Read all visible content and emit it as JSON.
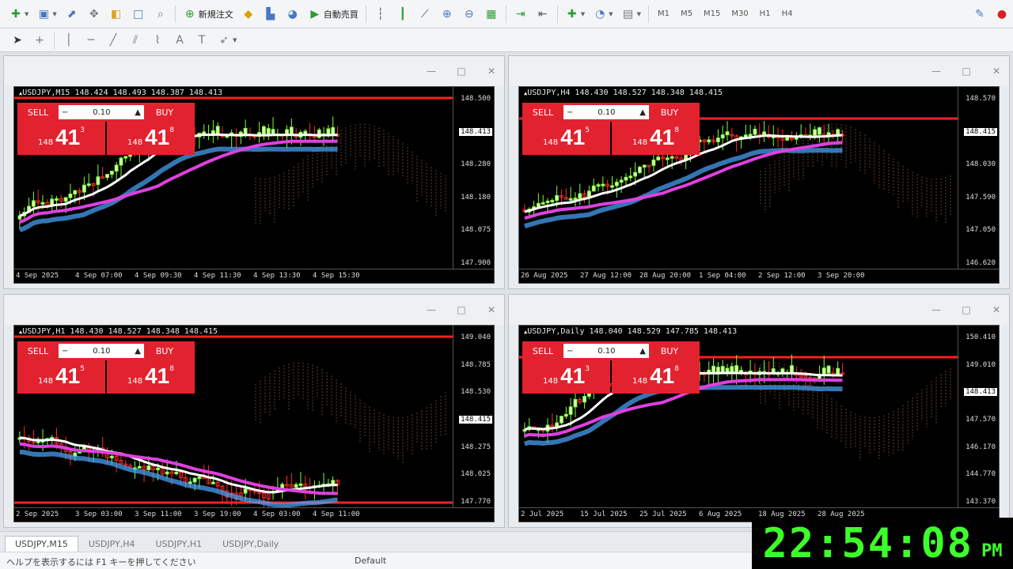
{
  "toolbar": {
    "items": [
      {
        "name": "new-chart-icon",
        "glyph": "✚",
        "color": "#2e9b3a",
        "dropdown": true
      },
      {
        "name": "profiles-icon",
        "glyph": "▣",
        "color": "#4a78c2",
        "dropdown": true
      },
      {
        "name": "market-watch-icon",
        "glyph": "⬈",
        "color": "#4a78c2"
      },
      {
        "name": "data-window-icon",
        "glyph": "✥",
        "color": "#777"
      },
      {
        "name": "navigator-icon",
        "glyph": "◧",
        "color": "#e0a020"
      },
      {
        "name": "terminal-icon",
        "glyph": "□",
        "color": "#4a78c2"
      },
      {
        "name": "strategy-tester-icon",
        "glyph": "⌕",
        "color": "#777"
      },
      {
        "sep": true
      },
      {
        "name": "new-order-icon",
        "glyph": "⊕",
        "color": "#2e9b3a",
        "text": "新規注文"
      },
      {
        "name": "metaeditor-icon",
        "glyph": "◆",
        "color": "#d9a000"
      },
      {
        "name": "signals-icon",
        "glyph": "▙",
        "color": "#4a78c2"
      },
      {
        "name": "market-icon",
        "glyph": "◕",
        "color": "#4a78c2"
      },
      {
        "name": "auto-trading-icon",
        "glyph": "▶",
        "color": "#2e9b3a",
        "text": "自動売買"
      },
      {
        "sep": true
      },
      {
        "name": "bar-chart-icon",
        "glyph": "┆",
        "color": "#555"
      },
      {
        "name": "candle-chart-icon",
        "glyph": "┃",
        "color": "#2e9b3a"
      },
      {
        "name": "line-chart-icon",
        "glyph": "⟋",
        "color": "#555"
      },
      {
        "name": "zoom-in-icon",
        "glyph": "⊕",
        "color": "#4a78c2"
      },
      {
        "name": "zoom-out-icon",
        "glyph": "⊖",
        "color": "#4a78c2"
      },
      {
        "name": "tile-windows-icon",
        "glyph": "▦",
        "color": "#2e9b3a"
      },
      {
        "sep": true
      },
      {
        "name": "auto-scroll-icon",
        "glyph": "⇥",
        "color": "#2e9b3a"
      },
      {
        "name": "chart-shift-icon",
        "glyph": "⇤",
        "color": "#555"
      },
      {
        "sep": true
      },
      {
        "name": "indicators-icon",
        "glyph": "✚",
        "color": "#2e9b3a",
        "dropdown": true
      },
      {
        "name": "periods-icon",
        "glyph": "◔",
        "color": "#4a78c2",
        "dropdown": true
      },
      {
        "name": "templates-icon",
        "glyph": "▤",
        "color": "#777",
        "dropdown": true
      }
    ],
    "timeframes": [
      "M1",
      "M5",
      "M15",
      "M30",
      "H1",
      "H4"
    ],
    "right_icons": [
      {
        "name": "options-icon",
        "glyph": "✎",
        "color": "#4a78c2"
      },
      {
        "name": "alert-icon",
        "glyph": "●",
        "color": "#d92020"
      }
    ]
  },
  "toolbar2": {
    "items": [
      {
        "name": "cursor-icon",
        "glyph": "➤",
        "color": "#333"
      },
      {
        "name": "crosshair-icon",
        "glyph": "+",
        "color": "#777"
      },
      {
        "sep": true
      },
      {
        "name": "vertical-line-icon",
        "glyph": "│",
        "color": "#777"
      },
      {
        "name": "horizontal-line-icon",
        "glyph": "─",
        "color": "#777"
      },
      {
        "name": "trendline-icon",
        "glyph": "╱",
        "color": "#777"
      },
      {
        "name": "channel-icon",
        "glyph": "⫽",
        "color": "#777"
      },
      {
        "name": "fibonacci-icon",
        "glyph": "⌇",
        "color": "#777"
      },
      {
        "name": "text-icon",
        "glyph": "A",
        "color": "#777"
      },
      {
        "name": "label-icon",
        "glyph": "T",
        "color": "#777"
      },
      {
        "name": "arrows-icon",
        "glyph": "➶",
        "color": "#777",
        "dropdown": true
      }
    ]
  },
  "charts": [
    {
      "id": "usdjpy-m15",
      "header": "USDJPY,M15  148.424 148.493 148.387 148.413",
      "lot": "0.10",
      "sell": "SELL",
      "buy": "BUY",
      "bid": {
        "big": "148",
        "main": "41",
        "sup": "3"
      },
      "ask": {
        "big": "148",
        "main": "41",
        "sup": "8"
      },
      "price_ticks": [
        "148.500",
        "148.413",
        "148.280",
        "148.180",
        "148.075",
        "147.900"
      ],
      "current_price": "148.413",
      "time_ticks": [
        "4 Sep 2025",
        "4 Sep 07:00",
        "4 Sep 09:30",
        "4 Sep 11:30",
        "4 Sep 13:30",
        "4 Sep 15:30"
      ]
    },
    {
      "id": "usdjpy-h4",
      "header": "USDJPY,H4  148.430 148.527 148.348 148.415",
      "lot": "0.10",
      "sell": "SELL",
      "buy": "BUY",
      "bid": {
        "big": "148",
        "main": "41",
        "sup": "5"
      },
      "ask": {
        "big": "148",
        "main": "41",
        "sup": "8"
      },
      "price_ticks": [
        "148.570",
        "148.415",
        "148.030",
        "147.590",
        "147.050",
        "146.620"
      ],
      "current_price": "148.415",
      "time_ticks": [
        "26 Aug 2025",
        "27 Aug 12:00",
        "28 Aug 20:00",
        "1 Sep 04:00",
        "2 Sep 12:00",
        "3 Sep 20:00"
      ]
    },
    {
      "id": "usdjpy-h1",
      "header": "USDJPY,H1  148.430 148.527 148.348 148.415",
      "lot": "0.10",
      "sell": "SELL",
      "buy": "BUY",
      "bid": {
        "big": "148",
        "main": "41",
        "sup": "5"
      },
      "ask": {
        "big": "148",
        "main": "41",
        "sup": "8"
      },
      "price_ticks": [
        "149.040",
        "148.785",
        "148.530",
        "148.415",
        "148.275",
        "148.025",
        "147.770"
      ],
      "current_price": "148.415",
      "time_ticks": [
        "2 Sep 2025",
        "3 Sep 03:00",
        "3 Sep 11:00",
        "3 Sep 19:00",
        "4 Sep 03:00",
        "4 Sep 11:00"
      ]
    },
    {
      "id": "usdjpy-daily",
      "header": "USDJPY,Daily  148.040 148.529 147.785 148.413",
      "lot": "0.10",
      "sell": "SELL",
      "buy": "BUY",
      "bid": {
        "big": "148",
        "main": "41",
        "sup": "3"
      },
      "ask": {
        "big": "148",
        "main": "41",
        "sup": "8"
      },
      "price_ticks": [
        "150.410",
        "149.010",
        "148.413",
        "147.570",
        "146.170",
        "144.770",
        "143.370"
      ],
      "current_price": "148.413",
      "time_ticks": [
        "2 Jul 2025",
        "15 Jul 2025",
        "25 Jul 2025",
        "6 Aug 2025",
        "18 Aug 2025",
        "28 Aug 2025"
      ]
    }
  ],
  "tabs": [
    "USDJPY,M15",
    "USDJPY,H4",
    "USDJPY,H1",
    "USDJPY,Daily"
  ],
  "status": {
    "left": "ヘルプを表示するには F1 キーを押してください",
    "mid": "Default"
  },
  "clock": {
    "time": "22:54:08",
    "ampm": "PM"
  },
  "colors": {
    "panel_red": "#e3222f",
    "up": "#7fff3a",
    "down": "#ff2a2a",
    "ma_fast": "#ffffff",
    "ma_slow": "#e040e0",
    "band": "#4aa8ff",
    "level": "#ff1f1f"
  }
}
